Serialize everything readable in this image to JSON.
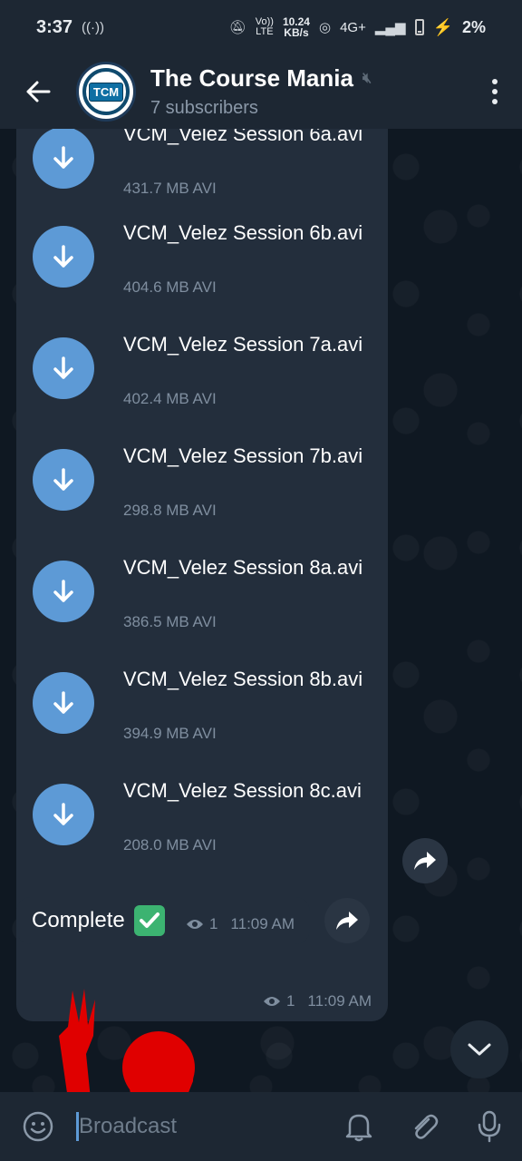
{
  "status": {
    "time": "3:37",
    "net_speed_top": "10.24",
    "net_speed_bottom": "KB/s",
    "volte_top": "Vo))",
    "volte_bottom": "LTE",
    "network": "4G+",
    "battery": "2%"
  },
  "header": {
    "title": "The Course Mania",
    "subtitle": "7 subscribers",
    "avatar_badge": "TCM",
    "avatar_ring_top": "THE COURSE",
    "avatar_ring_bottom": "MANIA"
  },
  "files": [
    {
      "name": "VCM_Velez Session 6a.avi",
      "meta": "431.7 MB AVI"
    },
    {
      "name": "VCM_Velez Session 6b.avi",
      "meta": "404.6 MB AVI"
    },
    {
      "name": "VCM_Velez Session 7a.avi",
      "meta": "402.4 MB AVI"
    },
    {
      "name": "VCM_Velez Session 7b.avi",
      "meta": "298.8 MB AVI"
    },
    {
      "name": "VCM_Velez Session 8a.avi",
      "meta": "386.5 MB AVI"
    },
    {
      "name": "VCM_Velez Session 8b.avi",
      "meta": "394.9 MB AVI"
    },
    {
      "name": "VCM_Velez Session 8c.avi",
      "meta": "208.0 MB AVI"
    }
  ],
  "files_message": {
    "views": "1",
    "time": "11:09 AM"
  },
  "complete_message": {
    "text": "Complete",
    "views": "1",
    "time": "11:09 AM"
  },
  "input": {
    "placeholder": "Broadcast"
  },
  "colors": {
    "accent": "#5d9ad6",
    "bubble": "#232e3c",
    "header": "#1d2733",
    "check": "#3cb371"
  }
}
